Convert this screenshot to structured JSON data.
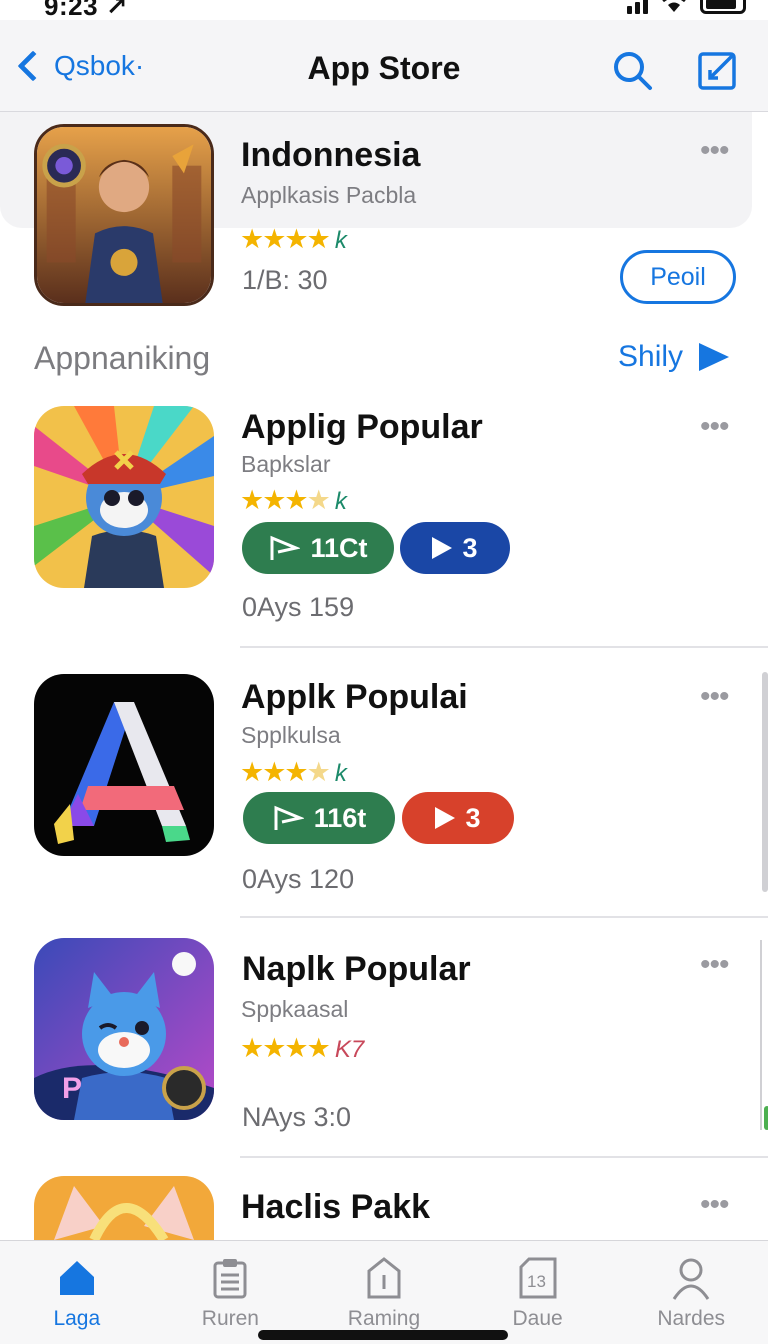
{
  "status_bar": {
    "time": "9:23 ↗"
  },
  "nav": {
    "back_label": "Qsbok·",
    "title": "App Store",
    "search_icon": "search-icon",
    "compose_icon": "compose-icon"
  },
  "featured": {
    "name": "Indonnesia",
    "subtitle": "Applkasis Pacbla",
    "stars": "★★★★",
    "rating_suffix": "k",
    "meta": "1/B: 30",
    "action_label": "Peoil"
  },
  "section": {
    "title": "Appnaniking",
    "link_label": "Shily"
  },
  "apps": [
    {
      "name": "Applig Popular",
      "subtitle": "Bapkslar",
      "stars": "★★★",
      "rating_suffix": "k",
      "install_label": "11Ct",
      "play_label": "3",
      "play_color": "#1a47a6",
      "meta": "0Ays 159"
    },
    {
      "name": "Applk Populai",
      "subtitle": "Spplkulsa",
      "stars": "★★★",
      "rating_suffix": "k",
      "install_label": "116t",
      "play_label": "3",
      "play_color": "#d7412b",
      "meta": "0Ays 120"
    },
    {
      "name": "Naplk Popular",
      "subtitle": "Sppkaasal",
      "stars": "★★★★",
      "rating_suffix": "K7",
      "meta": "NAys 3:0"
    },
    {
      "name": "Haclis Pakk"
    }
  ],
  "tabs": [
    {
      "label": "Laga",
      "icon": "home-icon",
      "active": true
    },
    {
      "label": "Ruren",
      "icon": "clipboard-icon",
      "active": false
    },
    {
      "label": "Raming",
      "icon": "tag-icon",
      "active": false
    },
    {
      "label": "Daue",
      "icon": "calendar-icon",
      "active": false
    },
    {
      "label": "Nardes",
      "icon": "person-icon",
      "active": false
    }
  ],
  "colors": {
    "accent": "#1676e0",
    "star": "#f4b400",
    "install_green": "#2e7d4f"
  }
}
